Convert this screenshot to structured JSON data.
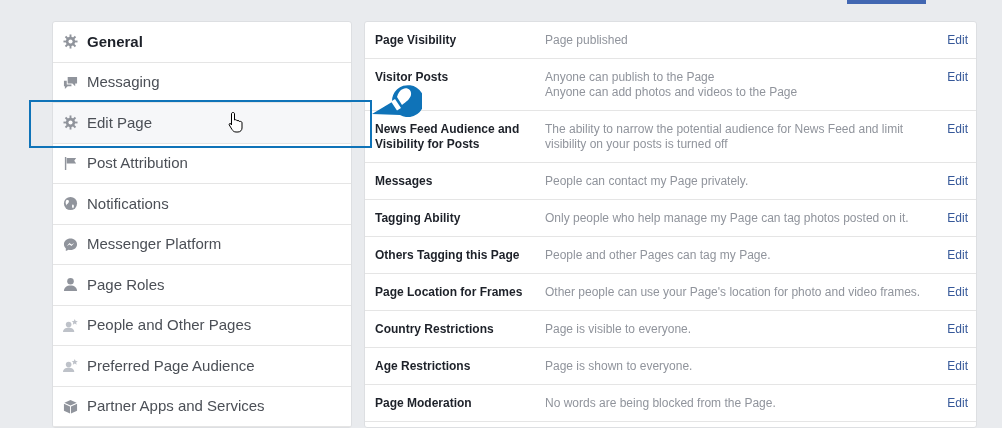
{
  "top_tab": {
    "selected": true
  },
  "sidebar": {
    "items": [
      {
        "label": "General",
        "selected": true,
        "highlighted": false
      },
      {
        "label": "Messaging",
        "selected": false,
        "highlighted": false
      },
      {
        "label": "Edit Page",
        "selected": false,
        "highlighted": true
      },
      {
        "label": "Post Attribution",
        "selected": false,
        "highlighted": false
      },
      {
        "label": "Notifications",
        "selected": false,
        "highlighted": false
      },
      {
        "label": "Messenger Platform",
        "selected": false,
        "highlighted": false
      },
      {
        "label": "Page Roles",
        "selected": false,
        "highlighted": false
      },
      {
        "label": "People and Other Pages",
        "selected": false,
        "highlighted": false
      },
      {
        "label": "Preferred Page Audience",
        "selected": false,
        "highlighted": false
      },
      {
        "label": "Partner Apps and Services",
        "selected": false,
        "highlighted": false
      }
    ]
  },
  "settings": {
    "rows": [
      {
        "label": "Page Visibility",
        "value": [
          "Page published"
        ],
        "action": "Edit"
      },
      {
        "label": "Visitor Posts",
        "value": [
          "Anyone can publish to the Page",
          "Anyone can add photos and videos to the Page"
        ],
        "action": "Edit"
      },
      {
        "label": "News Feed Audience and Visibility for Posts",
        "value": [
          "The ability to narrow the potential audience for News Feed and limit visibility on your posts is turned off"
        ],
        "action": "Edit"
      },
      {
        "label": "Messages",
        "value": [
          "People can contact my Page privately."
        ],
        "action": "Edit"
      },
      {
        "label": "Tagging Ability",
        "value": [
          "Only people who help manage my Page can tag photos posted on it."
        ],
        "action": "Edit"
      },
      {
        "label": "Others Tagging this Page",
        "value": [
          "People and other Pages can tag my Page."
        ],
        "action": "Edit"
      },
      {
        "label": "Page Location for Frames",
        "value": [
          "Other people can use your Page's location for photo and video frames."
        ],
        "action": "Edit"
      },
      {
        "label": "Country Restrictions",
        "value": [
          "Page is visible to everyone."
        ],
        "action": "Edit"
      },
      {
        "label": "Age Restrictions",
        "value": [
          "Page is shown to everyone."
        ],
        "action": "Edit"
      },
      {
        "label": "Page Moderation",
        "value": [
          "No words are being blocked from the Page."
        ],
        "action": "Edit"
      }
    ]
  }
}
